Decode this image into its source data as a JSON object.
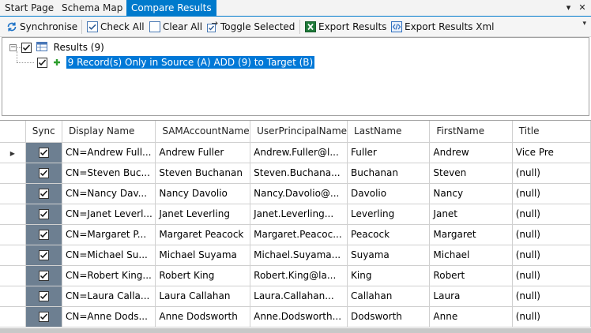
{
  "tabs": [
    {
      "label": "Start Page",
      "active": false
    },
    {
      "label": "Schema Map",
      "active": false
    },
    {
      "label": "Compare Results",
      "active": true
    }
  ],
  "window_controls": {
    "dropdown": "▾",
    "close": "✕"
  },
  "toolbar": {
    "synchronise": "Synchronise",
    "check_all": "Check All",
    "clear_all": "Clear All",
    "toggle_selected": "Toggle Selected",
    "export_results": "Export Results",
    "export_results_xml": "Export Results Xml",
    "overflow": "▾"
  },
  "tree": {
    "root_label": "Results (9)",
    "child_label": "9 Record(s) Only in Source (A) ADD (9) to Target (B)"
  },
  "grid": {
    "columns": [
      "Sync",
      "Display Name",
      "SAMAccountName",
      "UserPrincipalName",
      "LastName",
      "FirstName",
      "Title"
    ],
    "rows": [
      {
        "display": "CN=Andrew Full...",
        "sam": "Andrew Fuller",
        "upn": "Andrew.Fuller@l...",
        "last": "Fuller",
        "first": "Andrew",
        "title": "Vice Pre"
      },
      {
        "display": "CN=Steven Buc...",
        "sam": "Steven Buchanan",
        "upn": "Steven.Buchana...",
        "last": "Buchanan",
        "first": "Steven",
        "title": "(null)"
      },
      {
        "display": "CN=Nancy Dav...",
        "sam": "Nancy Davolio",
        "upn": "Nancy.Davolio@...",
        "last": "Davolio",
        "first": "Nancy",
        "title": "(null)"
      },
      {
        "display": "CN=Janet Leverl...",
        "sam": "Janet Leverling",
        "upn": "Janet.Leverling...",
        "last": "Leverling",
        "first": "Janet",
        "title": "(null)"
      },
      {
        "display": "CN=Margaret P...",
        "sam": "Margaret Peacock",
        "upn": "Margaret.Peacoc...",
        "last": "Peacock",
        "first": "Margaret",
        "title": "(null)"
      },
      {
        "display": "CN=Michael Su...",
        "sam": "Michael Suyama",
        "upn": "Michael.Suyama...",
        "last": "Suyama",
        "first": "Michael",
        "title": "(null)"
      },
      {
        "display": "CN=Robert King...",
        "sam": "Robert King",
        "upn": "Robert.King@la...",
        "last": "King",
        "first": "Robert",
        "title": "(null)"
      },
      {
        "display": "CN=Laura Calla...",
        "sam": "Laura Callahan",
        "upn": "Laura.Callahan...",
        "last": "Callahan",
        "first": "Laura",
        "title": "(null)"
      },
      {
        "display": "CN=Anne Dods...",
        "sam": "Anne Dodsworth",
        "upn": "Anne.Dodsworth...",
        "last": "Dodsworth",
        "first": "Anne",
        "title": "(null)"
      }
    ],
    "current_row_marker": "▶"
  },
  "colors": {
    "accent": "#007acc",
    "sync_cell": "#6d7f91",
    "selection": "#0078d7"
  }
}
